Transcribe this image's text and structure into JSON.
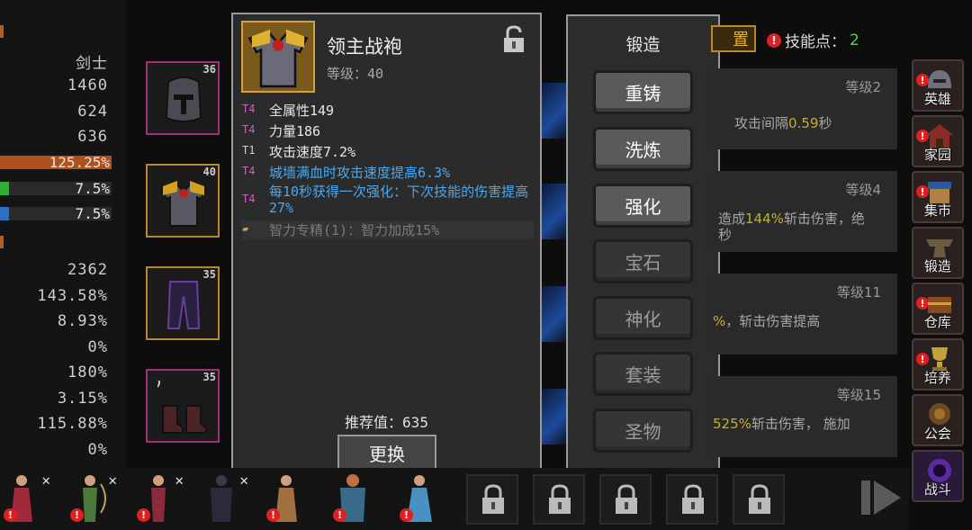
{
  "stats": {
    "class_name": "剑士",
    "values_top": [
      "1460",
      "624",
      "636"
    ],
    "bars": [
      {
        "value": "125.25%",
        "color": "#b0501c",
        "fill": 1.0
      },
      {
        "value": "7.5%",
        "color": "#30b030",
        "fill": 0.08
      },
      {
        "value": "7.5%",
        "color": "#2a70c8",
        "fill": 0.08
      }
    ],
    "values_bottom": [
      "2362",
      "143.58%",
      "8.93%",
      "0%",
      "180%",
      "3.15%",
      "115.88%",
      "0%"
    ]
  },
  "equipment": [
    {
      "level": "36",
      "name": "helmet-icon"
    },
    {
      "level": "40",
      "name": "armor-icon"
    },
    {
      "level": "35",
      "name": "leggings-icon"
    },
    {
      "level": "35",
      "name": "boots-icon"
    }
  ],
  "item": {
    "name": "领主战袍",
    "level_label": "等级：40",
    "attributes": [
      {
        "tier": "T4",
        "text": "全属性149",
        "style": "white"
      },
      {
        "tier": "T4",
        "text": "力量186",
        "style": "white"
      },
      {
        "tier": "T1",
        "text": "攻击速度7.2%",
        "style": "white"
      },
      {
        "tier": "T4",
        "text": "城墙满血时攻击速度提高6.3%",
        "style": "blue"
      },
      {
        "tier": "T4",
        "text": "每10秒获得一次强化：下次技能的伤害提高27%",
        "style": "blue"
      },
      {
        "tier": "",
        "text": "智力专精(1)：智力加成15%",
        "style": "gray"
      }
    ],
    "recommend": "推荐值：635",
    "replace_label": "更换"
  },
  "forge": {
    "title": "锻造",
    "buttons": [
      {
        "label": "重铸",
        "enabled": true
      },
      {
        "label": "洗炼",
        "enabled": true
      },
      {
        "label": "强化",
        "enabled": true
      },
      {
        "label": "宝石",
        "enabled": false
      },
      {
        "label": "神化",
        "enabled": false
      },
      {
        "label": "套装",
        "enabled": false
      },
      {
        "label": "圣物",
        "enabled": false
      }
    ]
  },
  "skills": {
    "reset_label": "置",
    "points_label": "技能点：",
    "points_value": "2",
    "cards": [
      {
        "level": "等级2",
        "desc_a": "攻击间隔",
        "desc_hl": "0.59",
        "desc_b": "秒",
        "desc2": ""
      },
      {
        "level": "等级4",
        "desc_a": "造成",
        "desc_hl": "144%",
        "desc_b": "斩击伤害，绝",
        "desc2": "秒"
      },
      {
        "level": "等级11",
        "desc_a": "",
        "desc_hl": "%",
        "desc_b": "，斩击伤害提高",
        "desc2": ""
      },
      {
        "level": "等级15",
        "desc_a": "",
        "desc_hl": "525%",
        "desc_b": "斩击伤害，  施加",
        "desc2": ""
      }
    ]
  },
  "nav": [
    "英雄",
    "家园",
    "集市",
    "锻造",
    "仓库",
    "培养",
    "公会",
    "战斗"
  ],
  "heroes_count": 7,
  "locked_slots": 5
}
